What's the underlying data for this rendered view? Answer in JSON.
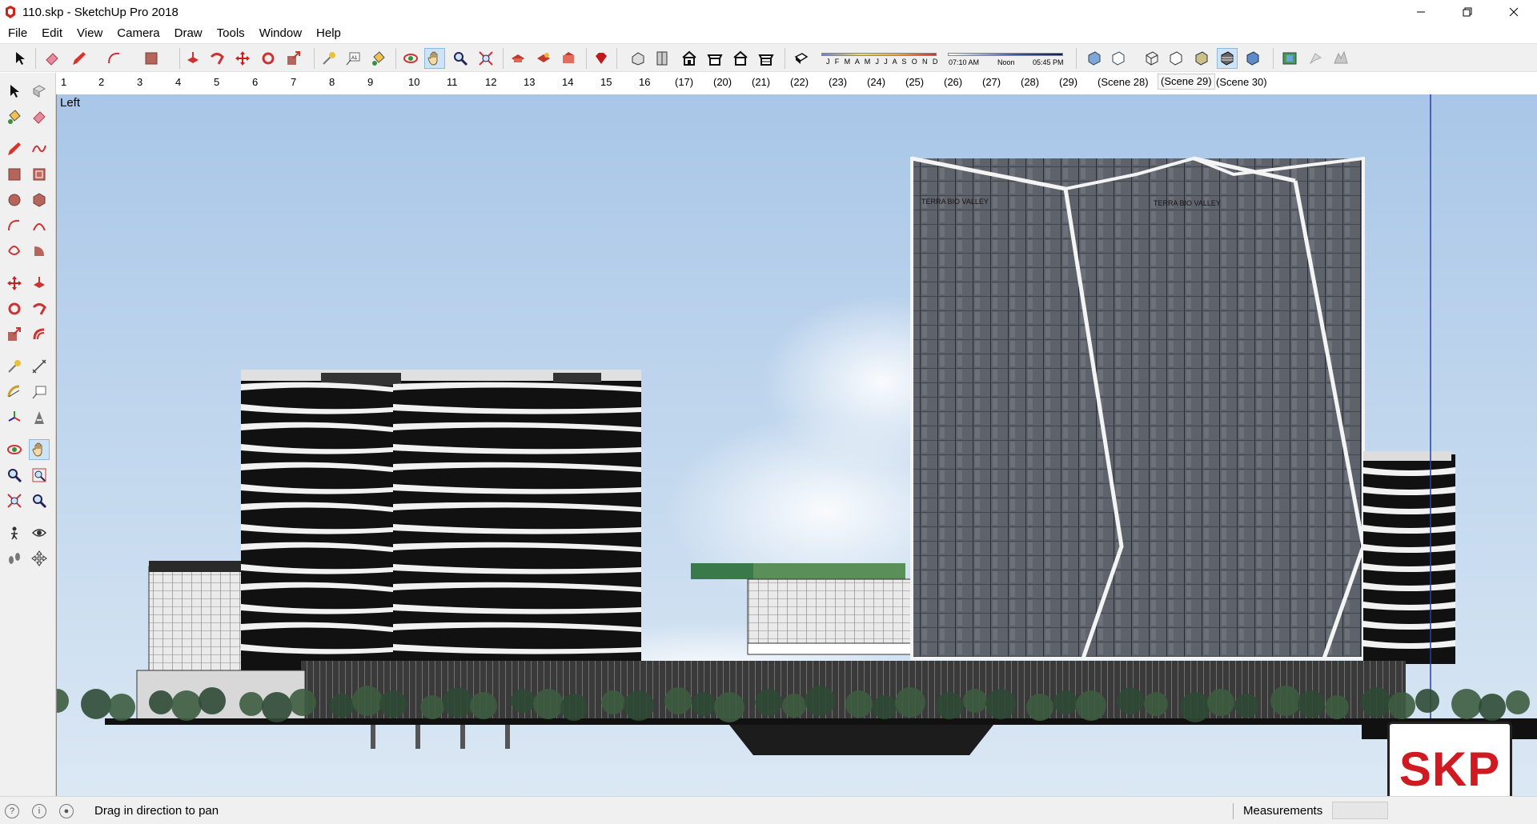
{
  "window": {
    "title": "110.skp - SketchUp Pro 2018",
    "minimize_icon": "minimize-icon",
    "maximize_icon": "restore-icon",
    "close_icon": "close-icon"
  },
  "menu": [
    "File",
    "Edit",
    "View",
    "Camera",
    "Draw",
    "Tools",
    "Window",
    "Help"
  ],
  "shadow": {
    "months": "J F M A M J J A S O N D",
    "time_start": "07:10 AM",
    "time_mid": "Noon",
    "time_end": "05:45 PM"
  },
  "scenes": [
    {
      "label": "1",
      "active": false
    },
    {
      "label": "2",
      "active": false
    },
    {
      "label": "3",
      "active": false
    },
    {
      "label": "4",
      "active": false
    },
    {
      "label": "5",
      "active": false
    },
    {
      "label": "6",
      "active": false
    },
    {
      "label": "7",
      "active": false
    },
    {
      "label": "8",
      "active": false
    },
    {
      "label": "9",
      "active": false
    },
    {
      "label": "10",
      "active": false
    },
    {
      "label": "11",
      "active": false
    },
    {
      "label": "12",
      "active": false
    },
    {
      "label": "13",
      "active": false
    },
    {
      "label": "14",
      "active": false
    },
    {
      "label": "15",
      "active": false
    },
    {
      "label": "16",
      "active": false
    },
    {
      "label": "(17)",
      "active": false
    },
    {
      "label": "(20)",
      "active": false
    },
    {
      "label": "(21)",
      "active": false
    },
    {
      "label": "(22)",
      "active": false
    },
    {
      "label": "(23)",
      "active": false
    },
    {
      "label": "(24)",
      "active": false
    },
    {
      "label": "(25)",
      "active": false
    },
    {
      "label": "(26)",
      "active": false
    },
    {
      "label": "(27)",
      "active": false
    },
    {
      "label": "(28)",
      "active": false
    },
    {
      "label": "(29)",
      "active": false
    },
    {
      "label": "(Scene 28)",
      "active": false
    },
    {
      "label": "(Scene 29)",
      "active": true
    },
    {
      "label": "(Scene 30)",
      "active": false
    }
  ],
  "viewport": {
    "view_label": "Left",
    "building_sign_1": "TERRA BIO VALLEY",
    "building_sign_2": "TERRA BIO VALLEY"
  },
  "status": {
    "text": "Drag in direction to pan",
    "measurements_label": "Measurements",
    "measurements_value": ""
  },
  "logo": "SKP",
  "colors": {
    "sky": "#b8d0ec",
    "glass": "#5a5f66",
    "accent_red": "#d01a22",
    "active_tool": "#cde3f7"
  }
}
